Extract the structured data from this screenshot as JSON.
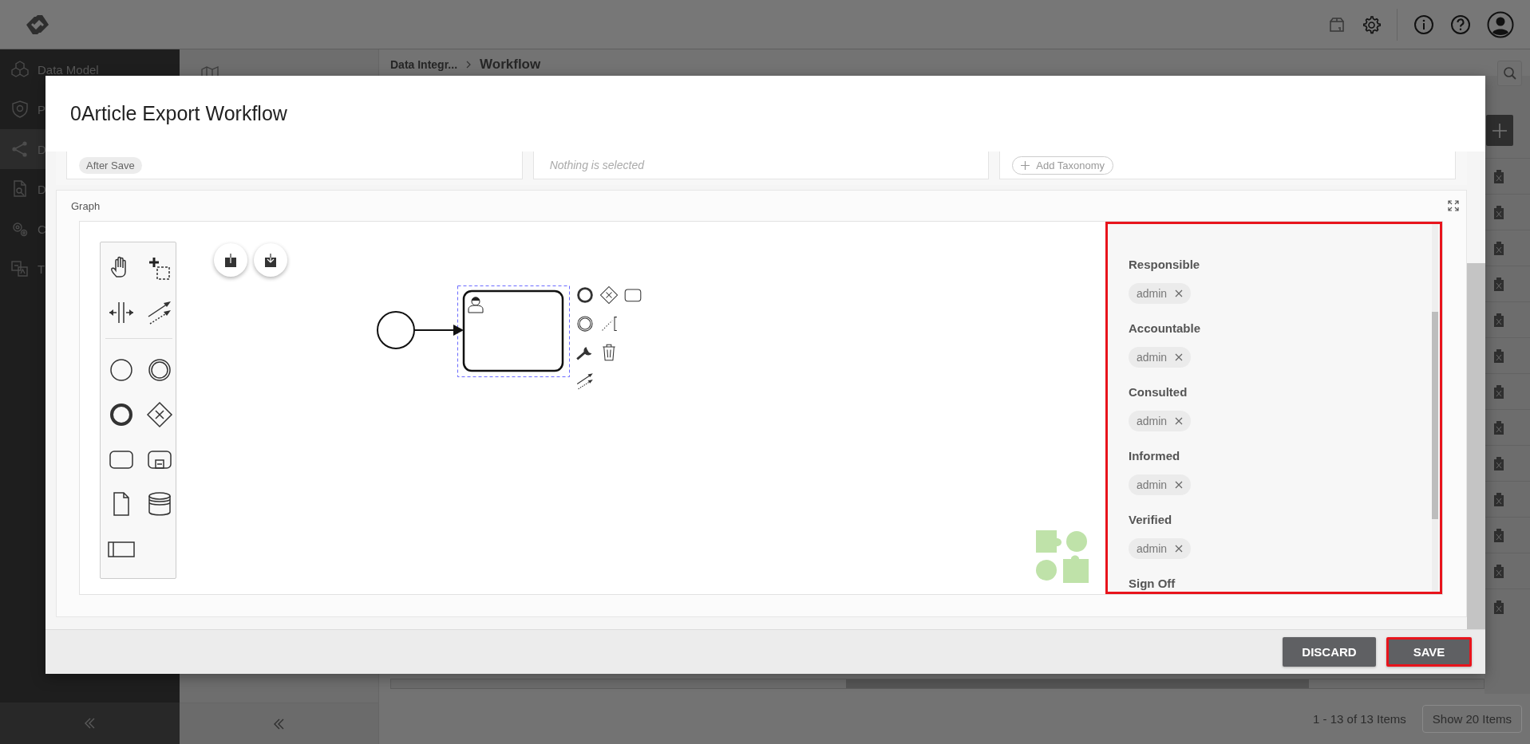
{
  "app": {
    "sidebar": [
      {
        "label": "Data Model",
        "selected": false
      },
      {
        "label": "P",
        "selected": false
      },
      {
        "label": "D",
        "selected": true
      },
      {
        "label": "D",
        "selected": false
      },
      {
        "label": "C",
        "selected": false
      },
      {
        "label": "T",
        "selected": false
      }
    ],
    "breadcrumb": [
      "Data Integr...",
      "Workflow"
    ],
    "pager": {
      "summary": "1 - 13 of 13 Items",
      "page_size_button": "Show 20 Items"
    }
  },
  "dialog": {
    "title": "0Article Export Workflow",
    "cards": [
      {
        "kind": "chip",
        "text": "After Save"
      },
      {
        "kind": "placeholder",
        "text": "Nothing is selected"
      },
      {
        "kind": "add",
        "text": "Add Taxonomy"
      }
    ],
    "graph": {
      "title": "Graph",
      "properties_panel": {
        "highlighted": true,
        "fields": [
          {
            "label": "Responsible",
            "values": [
              "admin"
            ]
          },
          {
            "label": "Accountable",
            "values": [
              "admin"
            ]
          },
          {
            "label": "Consulted",
            "values": [
              "admin"
            ]
          },
          {
            "label": "Informed",
            "values": [
              "admin"
            ]
          },
          {
            "label": "Verified",
            "values": [
              "admin"
            ]
          },
          {
            "label": "Sign Off"
          }
        ]
      }
    },
    "buttons": [
      {
        "label": "DISCARD",
        "highlighted": false
      },
      {
        "label": "SAVE",
        "highlighted": true
      }
    ]
  }
}
